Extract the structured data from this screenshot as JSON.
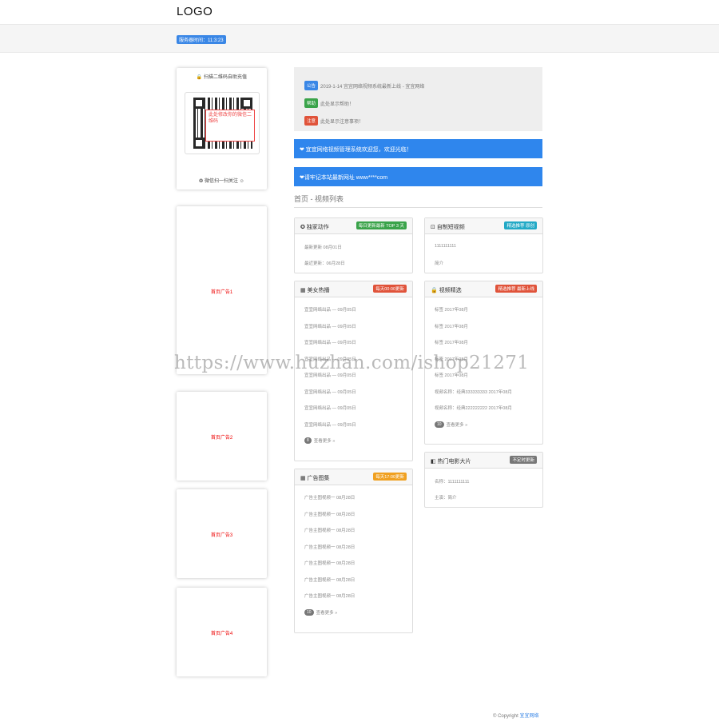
{
  "header": {
    "logo": "LOGO",
    "time_badge": "服务器时间：11:3:23"
  },
  "sidebar": {
    "qr_title": "🔒 扫描二维码自助充值",
    "qr_note": "此处修改你的微信二维码",
    "qr_foot": "❂ 微信扫一扫关注 ☺",
    "ads": [
      "首页广告1",
      "首页广告2",
      "首页广告3",
      "首页广告4"
    ]
  },
  "notices": [
    {
      "tag": "公告",
      "text": "2019-1-14 宜宜网络视频系统最新上线 - 宜宜网络",
      "tag_color": "#3a87e6"
    },
    {
      "tag": "帮助",
      "text": "此处显示帮助！",
      "tag_color": "#3aa34a"
    },
    {
      "tag": "注意",
      "text": "此处显示注意事项！",
      "tag_color": "#e0533a"
    }
  ],
  "bluebars": [
    "❤ 宜宜网络视频管理系统欢迎您，欢迎光临！",
    "❤请牢记本站最新网址 www****com"
  ],
  "section_title": "首页 - 视频列表",
  "panels": {
    "p1": {
      "title": "✪ 独家动作",
      "badge": "每日更新最新 TOP 3 天",
      "badge_color": "#3aa34a",
      "rows": [
        "最新更新 08月01日",
        "最近更新：06月28日"
      ]
    },
    "p2": {
      "title": "⊡ 自制短视频",
      "badge": "精选推荐 原创",
      "badge_color": "#22a9c6",
      "rows": [
        "1111111111",
        "简介"
      ]
    },
    "p3": {
      "title": "▦ 美女热播",
      "badge": "每天00:00更新",
      "badge_color": "#e0533a",
      "rows": [
        "宜宜网络出品 — 09月05日",
        "宜宜网络出品 — 09月05日",
        "宜宜网络出品 — 09月05日",
        "宜宜网络出品 — 09月05日",
        "宜宜网络出品 — 09月05日",
        "宜宜网络出品 — 09月05日",
        "宜宜网络出品 — 09月05日",
        "宜宜网络出品 — 09月05日"
      ],
      "more_count": "8",
      "more": "查看更多 »"
    },
    "p4": {
      "title": "🔒 视频精选",
      "badge": "精选推荐 最新上线",
      "badge_color": "#e0533a",
      "rows": [
        "标签 2017年08月",
        "标签 2017年08月",
        "标签 2017年08月",
        "标签 2017年08月",
        "标签 2017年08月",
        "视频名称：经典333333333 2017年08月",
        "视频名称：经典222222222 2017年08月"
      ],
      "more_count": "10",
      "more": "查看更多 »"
    },
    "p5": {
      "title": "▦ 广告图集",
      "badge": "每天17:00更新",
      "badge_color": "#f0a020",
      "rows": [
        "广告主图视频一 08月28日",
        "广告主图视频一 08月28日",
        "广告主图视频一 08月28日",
        "广告主图视频一 08月28日",
        "广告主图视频一 08月28日",
        "广告主图视频一 08月28日",
        "广告主图视频一 08月28日"
      ],
      "more_count": "10",
      "more": "查看更多 »"
    },
    "p6": {
      "title": "◧ 热门电影大片",
      "badge": "不定时更新",
      "badge_color": "#777777",
      "rows": [
        "名称：1111111111",
        "主演：简介"
      ]
    }
  },
  "footer": {
    "text": "© Copyright ",
    "link": "宜宜网络"
  },
  "watermark": "https://www.huzhan.com/ishop21271"
}
